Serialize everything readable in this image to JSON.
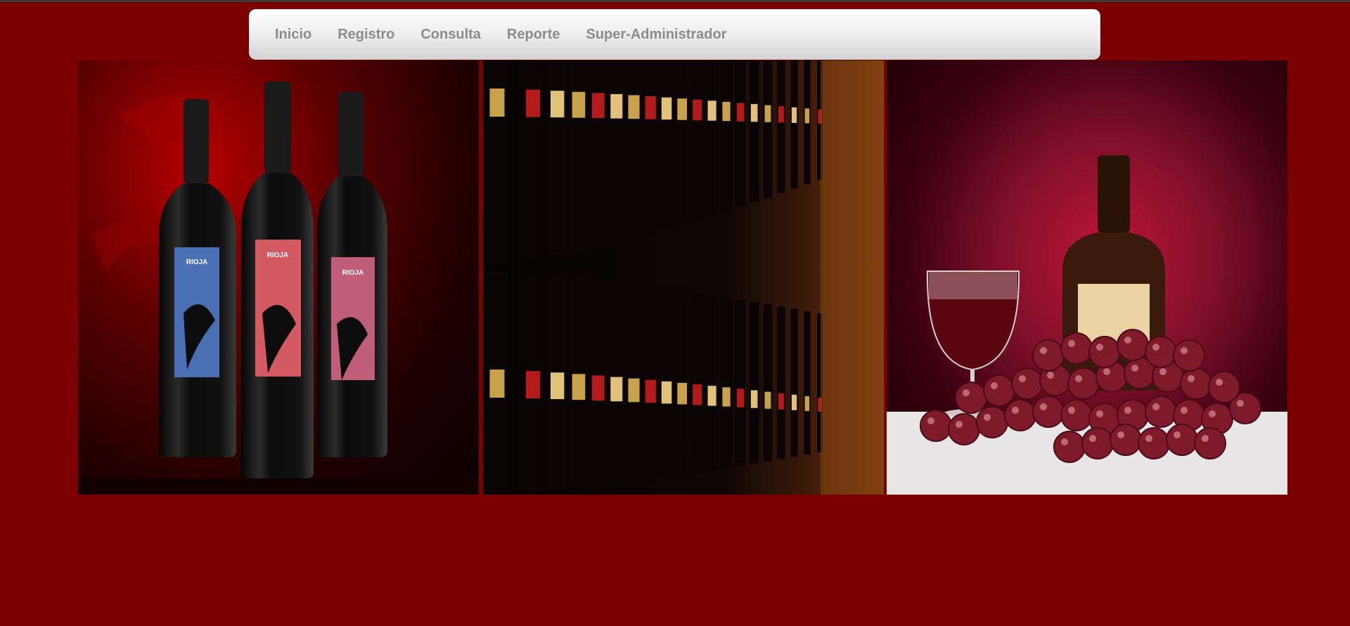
{
  "nav": {
    "items": [
      {
        "label": "Inicio"
      },
      {
        "label": "Registro"
      },
      {
        "label": "Consulta"
      },
      {
        "label": "Reporte"
      },
      {
        "label": "Super-Administrador"
      }
    ]
  },
  "gallery": {
    "images": [
      {
        "name": "wine-bottles-rioja-image",
        "label_text": "RIOJA"
      },
      {
        "name": "wine-cellar-shelves-image"
      },
      {
        "name": "wine-glass-grapes-image"
      }
    ]
  },
  "colors": {
    "page_background": "#7d0000",
    "nav_text": "#8c8c8c",
    "nav_background": "#ececec"
  }
}
